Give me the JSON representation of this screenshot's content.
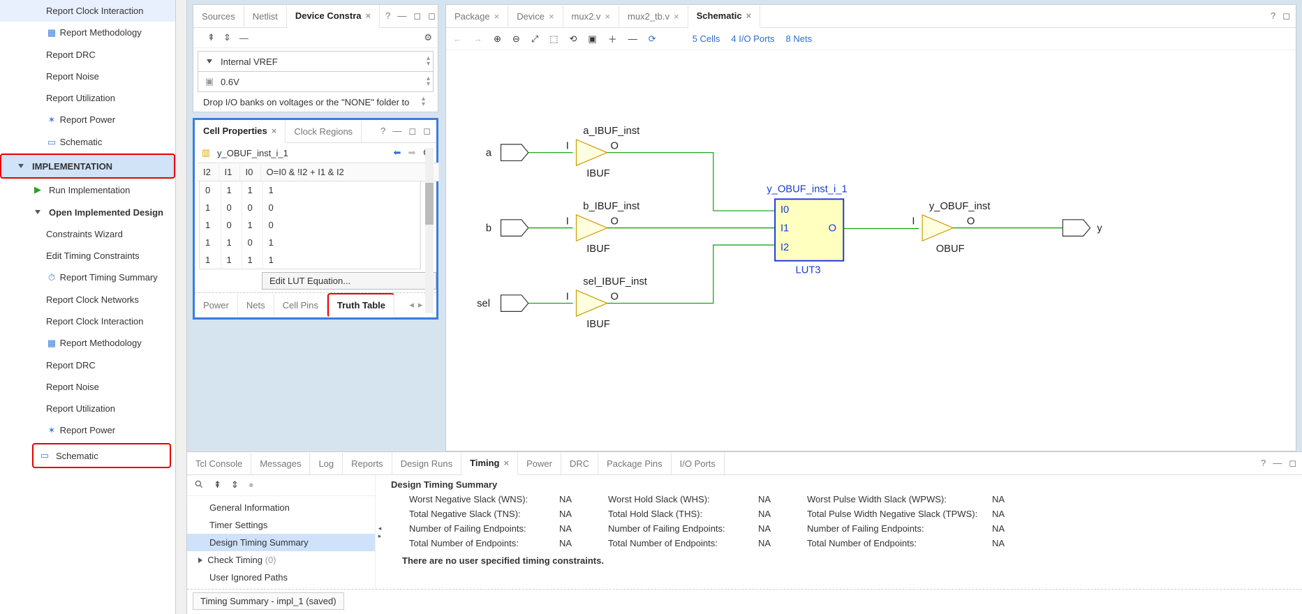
{
  "sidebar": {
    "syn_items": [
      "Report Clock Interaction",
      "Report Methodology",
      "Report DRC",
      "Report Noise",
      "Report Utilization",
      "Report Power",
      "Schematic"
    ],
    "header": "IMPLEMENTATION",
    "run_label": "Run Implementation",
    "open_label": "Open Implemented Design",
    "impl_items": [
      "Constraints Wizard",
      "Edit Timing Constraints",
      "Report Timing Summary",
      "Report Clock Networks",
      "Report Clock Interaction",
      "Report Methodology",
      "Report DRC",
      "Report Noise",
      "Report Utilization",
      "Report Power",
      "Schematic"
    ]
  },
  "sources": {
    "tabs": [
      "Sources",
      "Netlist",
      "Device Constra"
    ],
    "active_tab": 2,
    "vref_label": "Internal VREF",
    "vref_value": "0.6V",
    "drop_text": "Drop I/O banks on voltages or the \"NONE\" folder to"
  },
  "cellprops": {
    "tabs": [
      "Cell Properties",
      "Clock Regions"
    ],
    "cell_name": "y_OBUF_inst_i_1",
    "headers": [
      "I2",
      "I1",
      "I0",
      "O=I0 & !I2 + I1 & I2"
    ],
    "rows": [
      [
        "0",
        "1",
        "1",
        "1"
      ],
      [
        "1",
        "0",
        "0",
        "0"
      ],
      [
        "1",
        "0",
        "1",
        "0"
      ],
      [
        "1",
        "1",
        "0",
        "1"
      ],
      [
        "1",
        "1",
        "1",
        "1"
      ]
    ],
    "lut_button": "Edit LUT Equation...",
    "bottom_tabs": [
      "Power",
      "Nets",
      "Cell Pins",
      "Truth Table"
    ],
    "bottom_active": 3
  },
  "schematic": {
    "tabs": [
      "Package",
      "Device",
      "mux2.v",
      "mux2_tb.v",
      "Schematic"
    ],
    "active_tab": 4,
    "stats": [
      "5 Cells",
      "4 I/O Ports",
      "8 Nets"
    ],
    "ports": {
      "a": "a",
      "b": "b",
      "sel": "sel",
      "y": "y"
    },
    "insts": {
      "a": "a_IBUF_inst",
      "b": "b_IBUF_inst",
      "sel": "sel_IBUF_inst",
      "lut": "y_OBUF_inst_i_1",
      "obuf": "y_OBUF_inst"
    },
    "types": {
      "ibuf": "IBUF",
      "obuf": "OBUF",
      "lut": "LUT3"
    },
    "pins": {
      "I": "I",
      "O": "O",
      "I0": "I0",
      "I1": "I1",
      "I2": "I2"
    }
  },
  "bottom": {
    "tabs": [
      "Tcl Console",
      "Messages",
      "Log",
      "Reports",
      "Design Runs",
      "Timing",
      "Power",
      "DRC",
      "Package Pins",
      "I/O Ports"
    ],
    "active_tab": 5,
    "tree": [
      "General Information",
      "Timer Settings",
      "Design Timing Summary",
      "Check Timing",
      "User Ignored Paths"
    ],
    "tree_check_suffix": "(0)",
    "tree_selected": 2,
    "summary_title": "Design Timing Summary",
    "rows": [
      {
        "l1": "Worst Negative Slack (WNS):",
        "v1": "NA",
        "l2": "Worst Hold Slack (WHS):",
        "v2": "NA",
        "l3": "Worst Pulse Width Slack (WPWS):",
        "v3": "NA"
      },
      {
        "l1": "Total Negative Slack (TNS):",
        "v1": "NA",
        "l2": "Total Hold Slack (THS):",
        "v2": "NA",
        "l3": "Total Pulse Width Negative Slack (TPWS):",
        "v3": "NA"
      },
      {
        "l1": "Number of Failing Endpoints:",
        "v1": "NA",
        "l2": "Number of Failing Endpoints:",
        "v2": "NA",
        "l3": "Number of Failing Endpoints:",
        "v3": "NA"
      },
      {
        "l1": "Total Number of Endpoints:",
        "v1": "NA",
        "l2": "Total Number of Endpoints:",
        "v2": "NA",
        "l3": "Total Number of Endpoints:",
        "v3": "NA"
      }
    ],
    "note": "There are no user specified timing constraints.",
    "footer_tab": "Timing Summary - impl_1 (saved)"
  }
}
